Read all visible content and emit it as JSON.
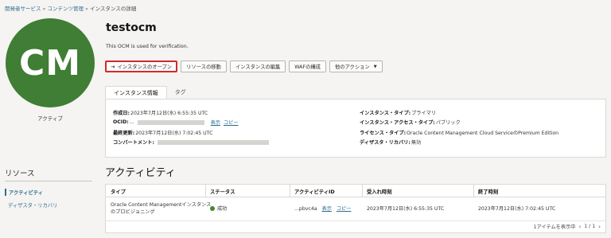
{
  "breadcrumb": {
    "items": [
      "開発者サービス",
      "コンテンツ管理",
      "インスタンスの詳細"
    ],
    "separator": "»"
  },
  "avatar": {
    "initials": "CM",
    "status": "アクティブ",
    "color": "#3f7e34"
  },
  "instance": {
    "name": "testocm",
    "description": "This OCM is used for verification."
  },
  "actions": {
    "open": "インスタンスのオープン",
    "move": "リソースの移動",
    "edit": "インスタンスの編集",
    "waf": "WAFの構成",
    "more": "他のアクション"
  },
  "tabs": [
    "インスタンス情報",
    "タグ"
  ],
  "info": {
    "created_label": "作成日:",
    "created_value": "2023年7月12日(水) 6:55:35 UTC",
    "ocid_label": "OCID:",
    "ocid_value": "...",
    "show_link": "表示",
    "copy_link": "コピー",
    "updated_label": "最終更新:",
    "updated_value": "2023年7月12日(水) 7:02:45 UTC",
    "compartment_label": "コンパートメント:",
    "type_label": "インスタンス・タイプ:",
    "type_value": "プライマリ",
    "access_label": "インスタンス・アクセス・タイプ:",
    "access_value": "パブリック",
    "license_label": "ライセンス・タイプ:",
    "license_value": "Oracle Content Management Cloud ServiceのPremium Edition",
    "dr_label": "ディザスタ・リカバリ:",
    "dr_value": "無効"
  },
  "resources": {
    "title": "リソース",
    "items": [
      "アクティビティ",
      "ディザスタ・リカバリ"
    ]
  },
  "activities": {
    "title": "アクティビティ",
    "headers": [
      "タイプ",
      "ステータス",
      "アクティビティID",
      "受入れ時刻",
      "終了時刻"
    ],
    "rows": [
      {
        "type_line1": "Oracle Content Managementインスタンス",
        "type_line2": "のプロビジョニング",
        "status": "成功",
        "id": "...pbvc4a",
        "show": "表示",
        "copy": "コピー",
        "accepted": "2023年7月12日(水) 6:55:35 UTC",
        "finished": "2023年7月12日(水) 7:02:45 UTC"
      }
    ],
    "pager_count": "1アイテムを表示中",
    "pager_pages": "1 / 1"
  }
}
